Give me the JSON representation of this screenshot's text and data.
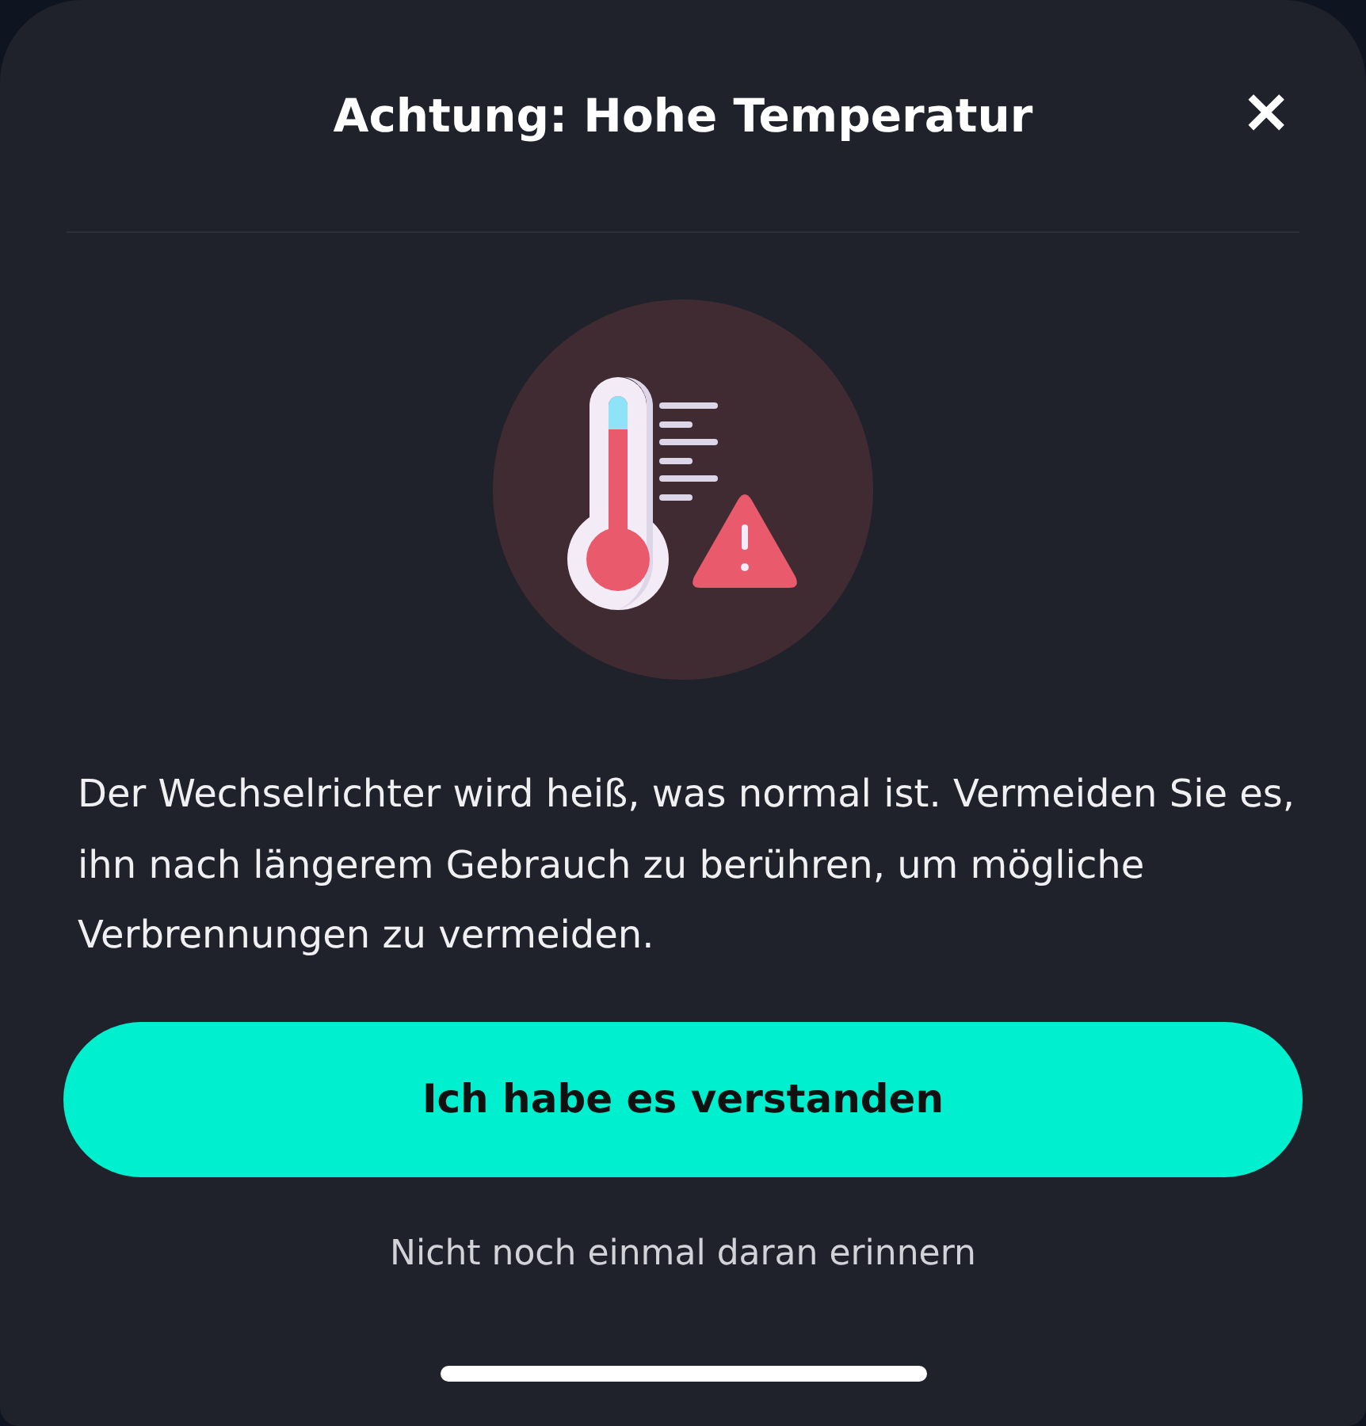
{
  "dialog": {
    "title": "Achtung: Hohe Temperatur",
    "close_label": "✕",
    "message": "Der Wechselrichter wird heiß, was normal ist. Vermeiden Sie es, ihn nach längerem Gebrauch zu berühren, um mögliche Verbrennungen zu vermeiden.",
    "primary_button": "Ich habe es verstanden",
    "secondary_link": "Nicht noch einmal daran erinnern"
  }
}
